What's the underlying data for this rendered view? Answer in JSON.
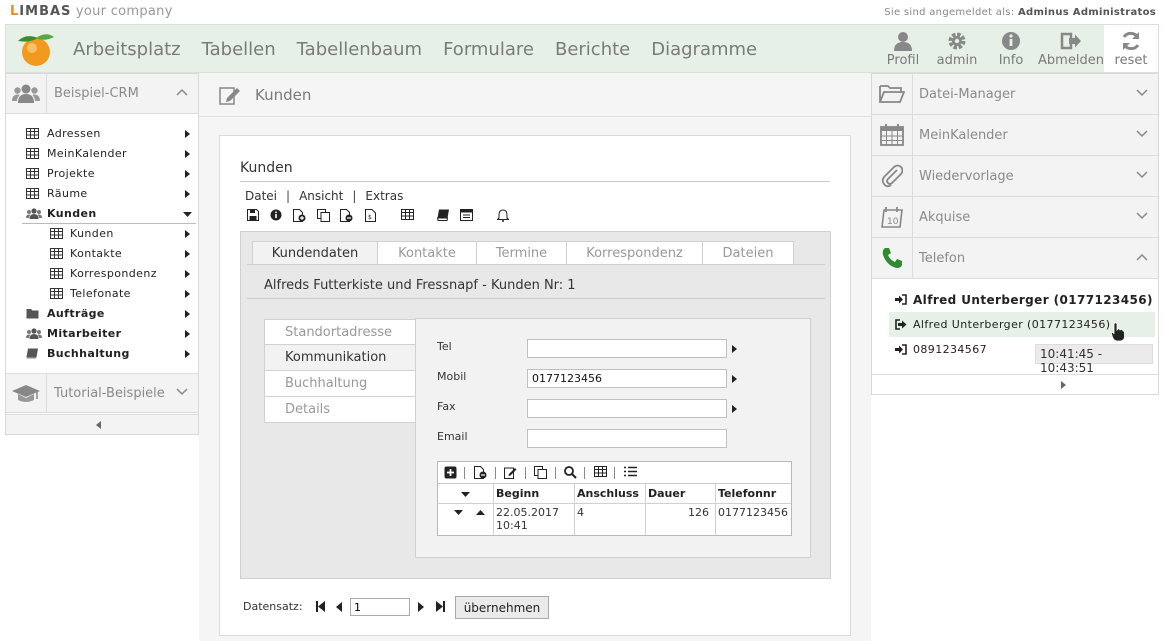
{
  "brand": {
    "logo_first": "L",
    "logo_rest": "IMBAS",
    "tagline": " your company"
  },
  "login": {
    "prefix": "Sie sind angemeldet als:",
    "user": "Adminus Administratos"
  },
  "nav": {
    "items": [
      "Arbeitsplatz",
      "Tabellen",
      "Tabellenbaum",
      "Formulare",
      "Berichte",
      "Diagramme"
    ],
    "tools": {
      "profil": "Profil",
      "admin": "admin",
      "info": "Info",
      "abmelden": "Abmelden",
      "reset": "reset"
    }
  },
  "left": {
    "group1": "Beispiel-CRM",
    "tree": {
      "adressen": "Adressen",
      "meinkalender": "MeinKalender",
      "projekte": "Projekte",
      "raeume": "Räume",
      "kunden": "Kunden",
      "kunden_sub": "Kunden",
      "kontakte": "Kontakte",
      "korrespondenz": "Korrespondenz",
      "telefonate": "Telefonate",
      "auftraege": "Aufträge",
      "mitarbeiter": "Mitarbeiter",
      "buchhaltung": "Buchhaltung"
    },
    "group2": "Tutorial-Beispiele"
  },
  "center": {
    "header_title": "Kunden",
    "form_title": "Kunden",
    "menu": {
      "datei": "Datei",
      "ansicht": "Ansicht",
      "extras": "Extras",
      "sep": "|"
    },
    "tabs": {
      "kundendaten": "Kundendaten",
      "kontakte": "Kontakte",
      "termine": "Termine",
      "korrespondenz": "Korrespondenz",
      "dateien": "Dateien"
    },
    "record": "Alfreds Futterkiste und Fressnapf - Kunden Nr: 1",
    "subtabs": {
      "standort": "Standortadresse",
      "kommunikation": "Kommunikation",
      "buchhaltung": "Buchhaltung",
      "details": "Details"
    },
    "fields": {
      "tel_label": "Tel",
      "tel_value": "",
      "mobil_label": "Mobil",
      "mobil_value": "0177123456",
      "fax_label": "Fax",
      "fax_value": "",
      "email_label": "Email",
      "email_value": ""
    },
    "table": {
      "headers": {
        "beginn": "Beginn",
        "anschluss": "Anschluss",
        "dauer": "Dauer",
        "telefonnr": "Telefonnr"
      },
      "row": {
        "beginn_date": "22.05.2017",
        "beginn_time": "10:41",
        "anschluss": "4",
        "dauer": "126",
        "telefonnr": "0177123456"
      }
    },
    "datensatz": {
      "label": "Datensatz:",
      "value": "1",
      "button": "übernehmen"
    }
  },
  "right": {
    "panels": {
      "datei": "Datei-Manager",
      "kalender": "MeinKalender",
      "wieder": "Wiedervorlage",
      "akquise": "Akquise",
      "telefon": "Telefon"
    },
    "calls": {
      "c1": "Alfred Unterberger (0177123456)",
      "c2": "Alfred Unterberger (0177123456)",
      "c3": "0891234567"
    },
    "time_tip": "10:41:45 - 10:43:51"
  },
  "colors": {
    "accent": "#e8892b",
    "nav_bg": "#e6f0e6",
    "phone_green": "#2e8b2e"
  }
}
